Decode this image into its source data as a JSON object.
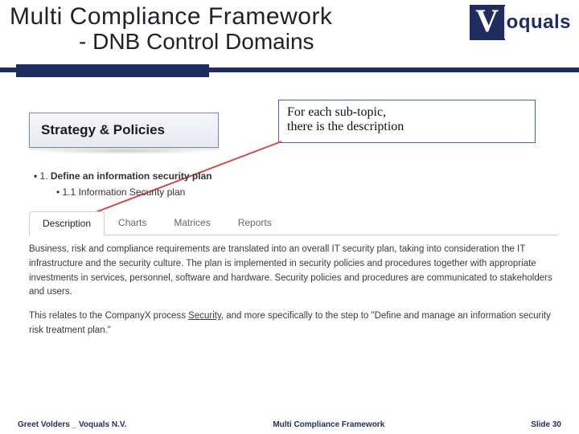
{
  "title": {
    "line1": "Multi Compliance Framework",
    "line2": "- DNB Control Domains"
  },
  "logo": {
    "initial": "V",
    "text": "oquals"
  },
  "section": {
    "label": "Strategy & Policies"
  },
  "callout": {
    "line1": "For each sub-topic,",
    "line2": "there is the description"
  },
  "list": {
    "item1_prefix": "1. ",
    "item1_label": "Define an information security plan",
    "item2": "1.1 Information Security plan"
  },
  "tabs": {
    "t0": "Description",
    "t1": "Charts",
    "t2": "Matrices",
    "t3": "Reports"
  },
  "body": {
    "p1": "Business, risk and compliance requirements are translated into an overall IT security plan, taking into consideration the IT infrastructure and the security culture. The plan is implemented in security policies and procedures together with appropriate investments in services, personnel, software and hardware. Security policies and procedures are communicated to stakeholders and users.",
    "p2a": "This relates to the CompanyX process ",
    "p2_link": "Security",
    "p2b": ", and more specifically to the step to \"Define and manage an information security risk treatment plan.\""
  },
  "footer": {
    "left": "Greet Volders _ Voquals N.V.",
    "center": "Multi Compliance Framework",
    "right": "Slide 30"
  }
}
